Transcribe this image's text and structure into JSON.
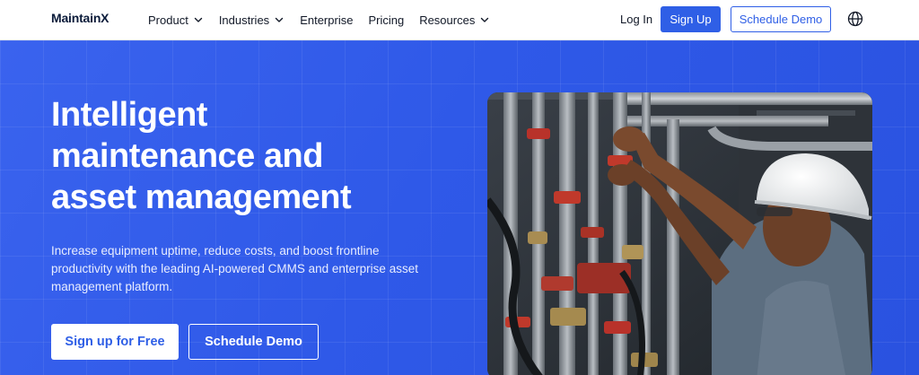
{
  "nav": {
    "logo": "MaintainX",
    "menu": [
      {
        "label": "Product",
        "has_dropdown": true
      },
      {
        "label": "Industries",
        "has_dropdown": true
      },
      {
        "label": "Enterprise",
        "has_dropdown": false
      },
      {
        "label": "Pricing",
        "has_dropdown": false
      },
      {
        "label": "Resources",
        "has_dropdown": true
      }
    ],
    "login_label": "Log In",
    "signup_label": "Sign Up",
    "demo_label": "Schedule Demo"
  },
  "hero": {
    "headline_lines": [
      "Intelligent",
      "maintenance and",
      "asset management"
    ],
    "subtitle": "Increase equipment uptime, reduce costs, and boost frontline productivity with the leading AI-powered CMMS and enterprise asset management platform.",
    "cta_primary": "Sign up for Free",
    "cta_secondary": "Schedule Demo"
  },
  "colors": {
    "brand_blue": "#2f5fe6",
    "hero_blue": "#3a63ee",
    "navy": "#0b1b3a"
  },
  "icons": [
    "chevron-down-icon",
    "globe-icon"
  ]
}
